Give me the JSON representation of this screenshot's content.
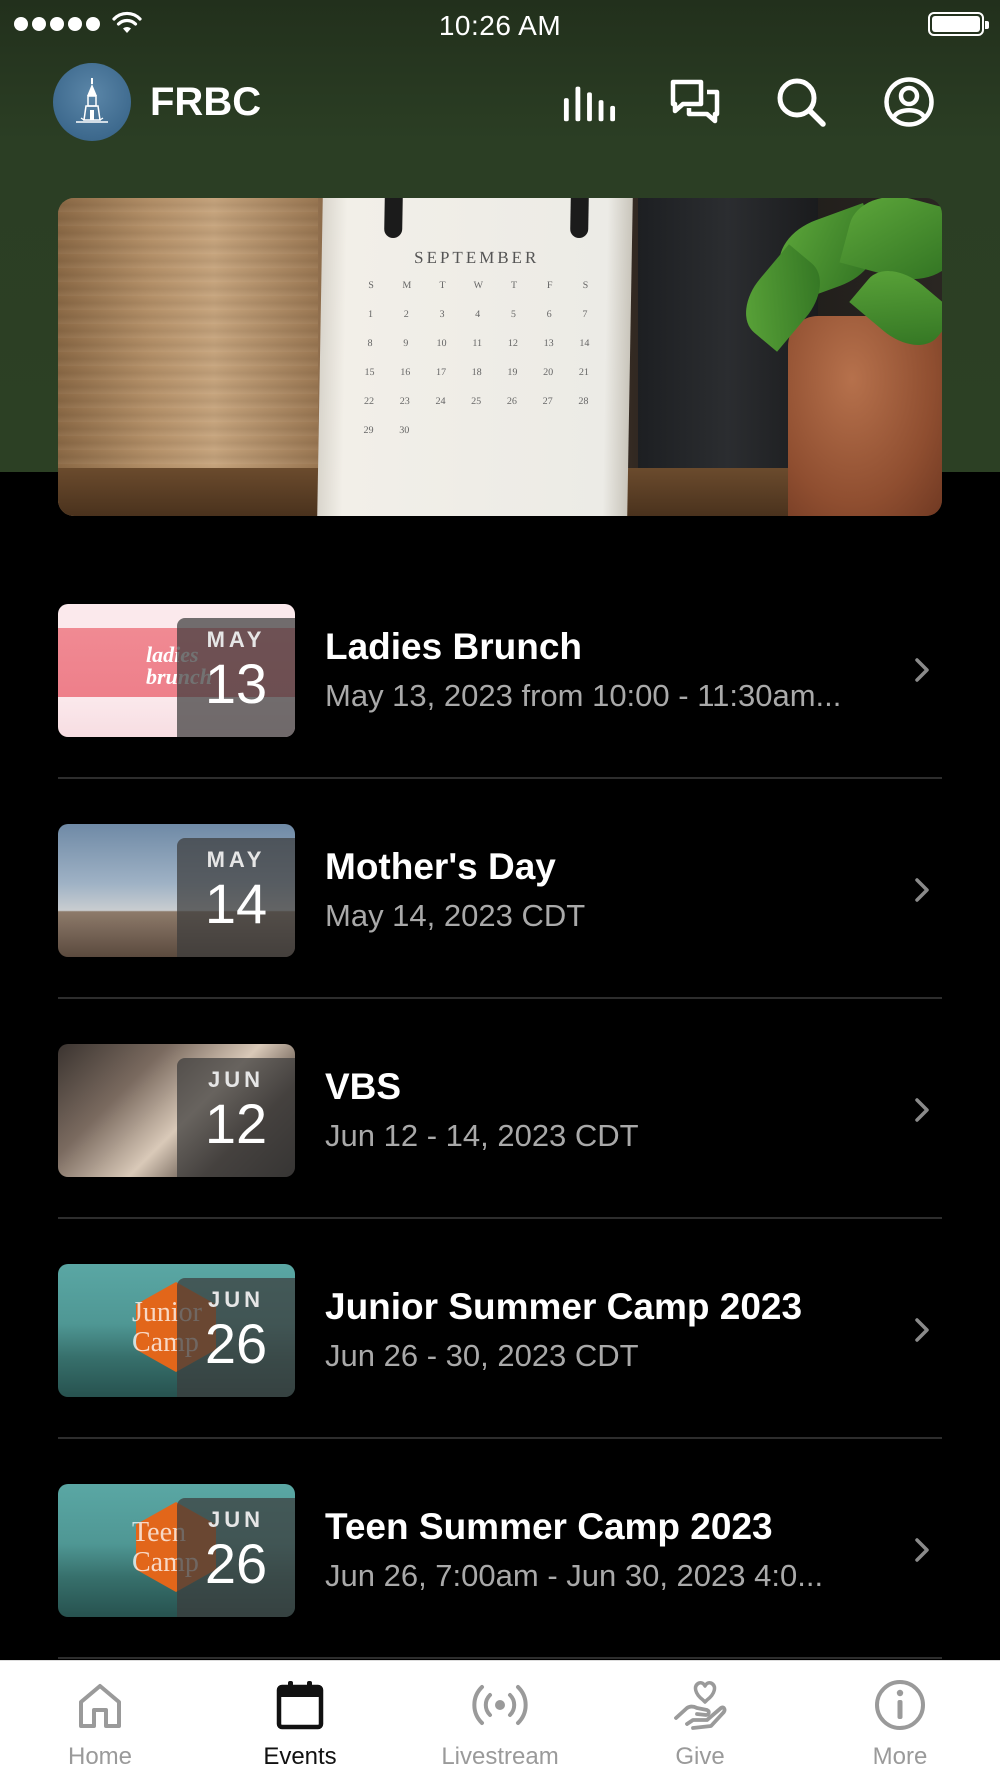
{
  "status_bar": {
    "time": "10:26 AM"
  },
  "header": {
    "brand": "FRBC"
  },
  "hero": {
    "calendar_month": "SEPTEMBER",
    "weekdays": [
      "S",
      "M",
      "T",
      "W",
      "T",
      "F",
      "S"
    ],
    "days": [
      "1",
      "2",
      "3",
      "4",
      "5",
      "6",
      "7",
      "8",
      "9",
      "10",
      "11",
      "12",
      "13",
      "14",
      "15",
      "16",
      "17",
      "18",
      "19",
      "20",
      "21",
      "22",
      "23",
      "24",
      "25",
      "26",
      "27",
      "28",
      "29",
      "30"
    ]
  },
  "events": [
    {
      "title": "Ladies Brunch",
      "subtitle": "May 13, 2023 from 10:00 - 11:30am...",
      "month": "MAY",
      "day": "13",
      "thumb_text": "ladies brunch"
    },
    {
      "title": "Mother's Day",
      "subtitle": "May 14, 2023 CDT",
      "month": "MAY",
      "day": "14"
    },
    {
      "title": "VBS",
      "subtitle": "Jun 12 - 14, 2023 CDT",
      "month": "JUN",
      "day": "12"
    },
    {
      "title": "Junior Summer Camp 2023",
      "subtitle": "Jun 26 - 30, 2023 CDT",
      "month": "JUN",
      "day": "26",
      "thumb_text": "Junior Camp"
    },
    {
      "title": "Teen Summer Camp 2023",
      "subtitle": "Jun 26, 7:00am - Jun 30, 2023 4:0...",
      "month": "JUN",
      "day": "26",
      "thumb_text": "Teen Camp"
    }
  ],
  "tabs": [
    {
      "label": "Home",
      "icon": "home-icon",
      "active": false
    },
    {
      "label": "Events",
      "icon": "calendar-icon",
      "active": true
    },
    {
      "label": "Livestream",
      "icon": "broadcast-icon",
      "active": false
    },
    {
      "label": "Give",
      "icon": "give-icon",
      "active": false
    },
    {
      "label": "More",
      "icon": "info-icon",
      "active": false
    }
  ],
  "colors": {
    "header_bg": "#2b3e24",
    "background": "#000000",
    "subtitle": "#a9a9a9",
    "tab_inactive": "#9a9a9a",
    "tab_active": "#111111"
  }
}
